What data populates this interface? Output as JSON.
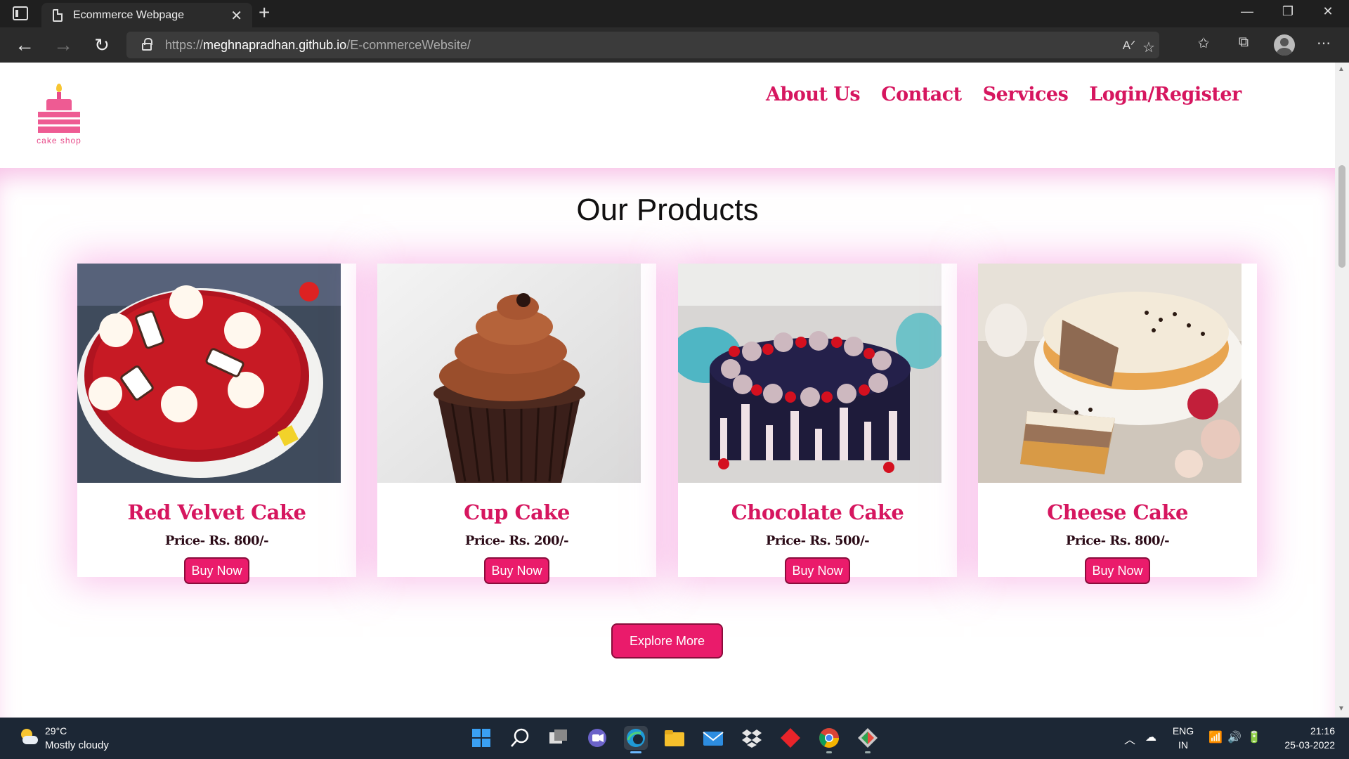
{
  "browser": {
    "tab_title": "Ecommerce Webpage",
    "url_scheme": "https://",
    "url_host": "meghnapradhan.github.io",
    "url_path": "/E-commerceWebsite/"
  },
  "header": {
    "logo_text": "cake shop",
    "nav": [
      "About Us",
      "Contact",
      "Services",
      "Login/Register"
    ]
  },
  "products": {
    "title": "Our Products",
    "buy_label": "Buy Now",
    "explore_label": "Explore More",
    "items": [
      {
        "name": "Red Velvet Cake",
        "price": "Price- Rs. 800/-"
      },
      {
        "name": "Cup Cake",
        "price": "Price- Rs. 200/-"
      },
      {
        "name": "Chocolate Cake",
        "price": "Price- Rs. 500/-"
      },
      {
        "name": "Cheese Cake",
        "price": "Price- Rs. 800/-"
      }
    ]
  },
  "taskbar": {
    "weather_temp": "29°C",
    "weather_desc": "Mostly cloudy",
    "lang_1": "ENG",
    "lang_2": "IN",
    "time": "21:16",
    "date": "25-03-2022"
  },
  "colors": {
    "brand": "#d6165f",
    "button": "#ea1b6b",
    "glow": "#f596dc"
  }
}
